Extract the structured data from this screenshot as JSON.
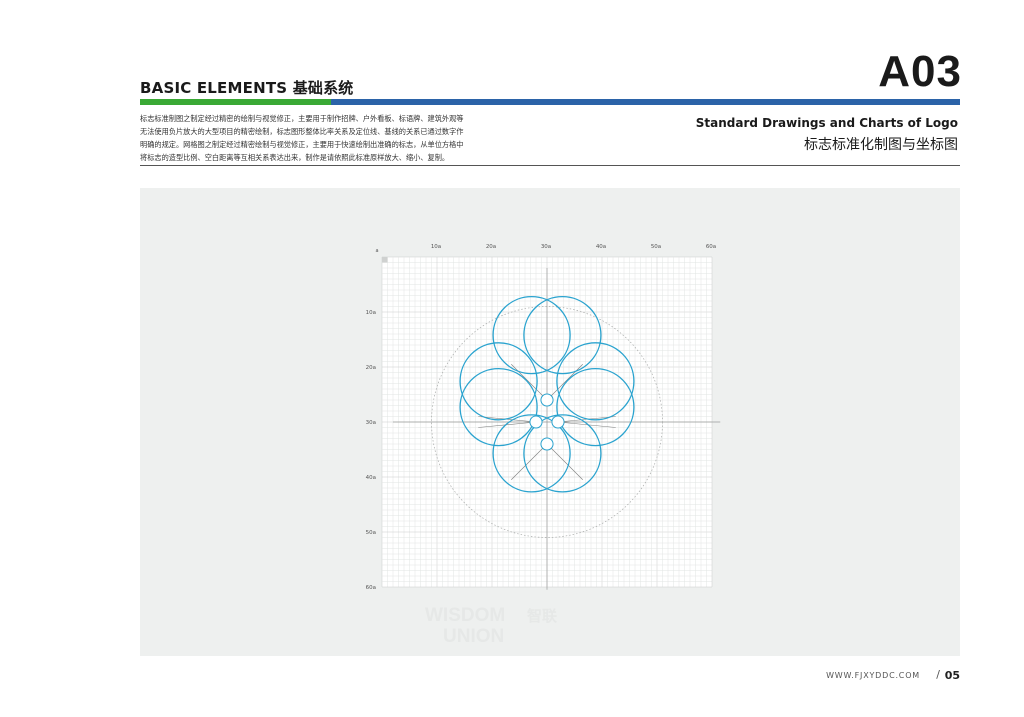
{
  "header": {
    "section_title": "BASIC ELEMENTS 基础系统",
    "page_code": "A03",
    "subtitle_en": "Standard Drawings and Charts of Logo",
    "subtitle_zh": "标志标准化制图与坐标图"
  },
  "intro": {
    "lines": [
      "标志标准制图之制定经过精密的绘制与视觉修正，主要用于制作招牌、户外看板、标语牌、建筑外观等",
      "无法使用负片放大的大型项目的精密绘制，标志图形整体比率关系及定位线、基线的关系已通过数字作",
      "明确的规定。网格图之制定经过精密绘制与视觉修正，主要用于快速绘制出准确的标志，从单位方格中",
      "将标志的造型比例、空白距离等互相关系表达出来，制作是请依照此标准原样放大、缩小、复制。"
    ]
  },
  "grid": {
    "origin_label": "a",
    "x_labels": [
      "10a",
      "20a",
      "30a",
      "40a",
      "50a",
      "60a"
    ],
    "y_labels": [
      "10a",
      "20a",
      "30a",
      "40a",
      "50a",
      "60a"
    ],
    "watermark_line1": "WISDOM",
    "watermark_cn": "智联",
    "watermark_line2": "UNION"
  },
  "footer": {
    "url": "WWW.FJXYDDC.COM",
    "slash": "/",
    "page_number": "05"
  },
  "colors": {
    "accent_green": "#3aa935",
    "accent_blue": "#2b63a8",
    "logo_blue": "#2aa3cf",
    "panel_bg": "#eef0ef"
  }
}
